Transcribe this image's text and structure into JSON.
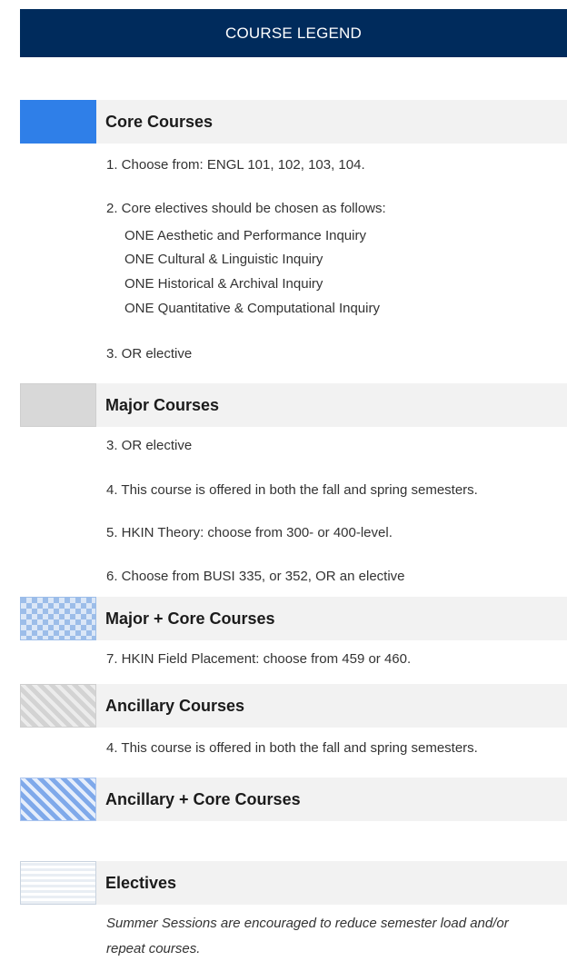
{
  "header": {
    "title": "COURSE LEGEND"
  },
  "sections": {
    "core": {
      "title": "Core Courses",
      "swatch_color": "#2f7fe8"
    },
    "major": {
      "title": "Major Courses",
      "swatch_color": "#d8d8d8"
    },
    "major_core": {
      "title": "Major + Core Courses",
      "swatch_pattern": "checkerboard-blue"
    },
    "ancillary": {
      "title": "Ancillary Courses",
      "swatch_pattern": "diagonal-grey"
    },
    "ancillary_core": {
      "title": "Ancillary + Core Courses",
      "swatch_pattern": "diagonal-blue"
    },
    "electives": {
      "title": "Electives",
      "swatch_pattern": "horizontal-lines"
    }
  },
  "notes": {
    "n1": "1. Choose from: ENGL 101, 102, 103, 104.",
    "n2": "2. Core electives should be chosen as follows:",
    "n2a": "ONE Aesthetic and Performance Inquiry",
    "n2b": "ONE Cultural & Linguistic Inquiry",
    "n2c": "ONE Historical & Archival Inquiry",
    "n2d": "ONE Quantitative & Computational Inquiry",
    "n3": "3. OR elective",
    "n4": "4. This course is offered in both the fall and spring semesters.",
    "n5": "5. HKIN Theory: choose from 300- or 400-level.",
    "n6": "6. Choose from BUSI 335, or 352, OR an elective",
    "n7": "7. HKIN Field Placement: choose from 459 or 460.",
    "electives_line1": "Summer Sessions are encouraged to reduce semester load and/or",
    "electives_line2": "repeat courses."
  },
  "colors": {
    "header_bg": "#002b5c",
    "bar_bg": "#f2f2f2"
  }
}
